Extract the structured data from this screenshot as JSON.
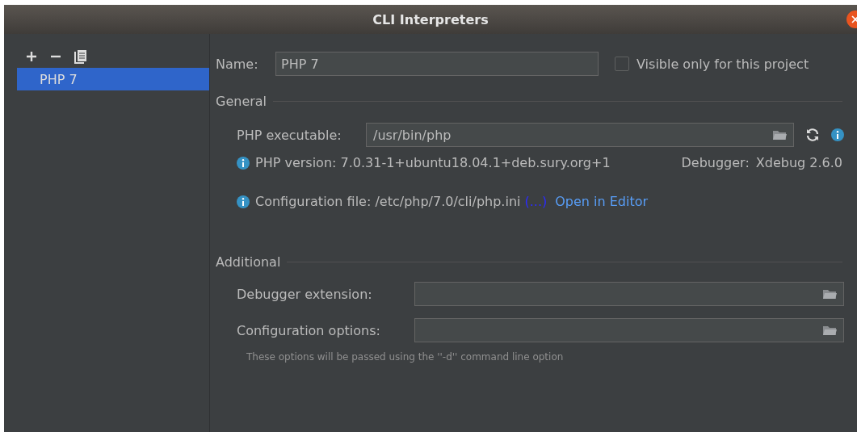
{
  "window": {
    "title": "CLI Interpreters"
  },
  "toolbar": [
    {
      "kind": "add"
    },
    {
      "kind": "remove"
    },
    {
      "kind": "copy"
    }
  ],
  "interpreters": [
    {
      "label": "PHP 7",
      "selected": true
    }
  ],
  "name_field": {
    "label": "Name:",
    "value": "PHP 7"
  },
  "visible_only": {
    "label": "Visible only for this project",
    "checked": false
  },
  "general": {
    "title": "General",
    "executable": {
      "label": "PHP executable:",
      "value": "/usr/bin/php"
    },
    "version": {
      "text": "PHP version: 7.0.31-1+ubuntu18.04.1+deb.sury.org+1",
      "debugger_label": "Debugger:",
      "debugger_value": "Xdebug 2.6.0"
    },
    "config": {
      "text": "Configuration file: /etc/php/7.0/cli/php.ini",
      "more_link": "(...)",
      "open_link": "Open in Editor"
    }
  },
  "additional": {
    "title": "Additional",
    "fields": [
      {
        "label": "Debugger extension:"
      },
      {
        "label": "Configuration options:"
      }
    ],
    "hint": "These options will be passed using the ''-d'' command line option"
  }
}
